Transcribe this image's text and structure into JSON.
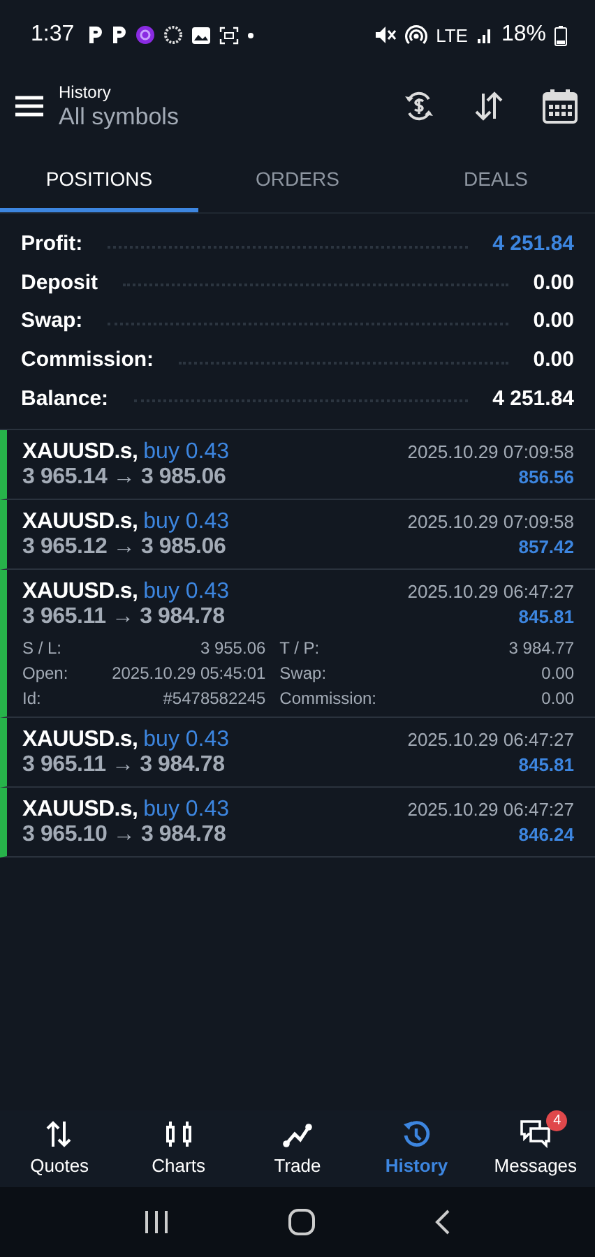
{
  "status_bar": {
    "time": "1:37",
    "network": "LTE",
    "battery": "18%"
  },
  "header": {
    "title": "History",
    "subtitle": "All symbols"
  },
  "tabs": [
    {
      "label": "POSITIONS",
      "selected": true
    },
    {
      "label": "ORDERS",
      "selected": false
    },
    {
      "label": "DEALS",
      "selected": false
    }
  ],
  "summary": [
    {
      "label": "Profit:",
      "value": "4 251.84",
      "highlighted": true
    },
    {
      "label": "Deposit",
      "value": "0.00",
      "highlighted": false
    },
    {
      "label": "Swap:",
      "value": "0.00",
      "highlighted": false
    },
    {
      "label": "Commission:",
      "value": "0.00",
      "highlighted": false
    },
    {
      "label": "Balance:",
      "value": "4 251.84",
      "highlighted": false
    }
  ],
  "positions": [
    {
      "symbol": "XAUUSD.s,",
      "side": "buy 0.43",
      "time": "2025.10.29 07:09:58",
      "prices": "3 965.14 → 3 985.06",
      "profit": "856.56"
    },
    {
      "symbol": "XAUUSD.s,",
      "side": "buy 0.43",
      "time": "2025.10.29 07:09:58",
      "prices": "3 965.12 → 3 985.06",
      "profit": "857.42"
    },
    {
      "symbol": "XAUUSD.s,",
      "side": "buy 0.43",
      "time": "2025.10.29 06:47:27",
      "prices": "3 965.11 → 3 984.78",
      "profit": "845.81",
      "details": [
        {
          "label": "S / L:",
          "value": "3 955.06"
        },
        {
          "label": "T / P:",
          "value": "3 984.77"
        },
        {
          "label": "Open:",
          "value": "2025.10.29 05:45:01"
        },
        {
          "label": "Swap:",
          "value": "0.00"
        },
        {
          "label": "Id:",
          "value": "#5478582245"
        },
        {
          "label": "Commission:",
          "value": "0.00"
        }
      ]
    },
    {
      "symbol": "XAUUSD.s,",
      "side": "buy 0.43",
      "time": "2025.10.29 06:47:27",
      "prices": "3 965.11 → 3 984.78",
      "profit": "845.81"
    },
    {
      "symbol": "XAUUSD.s,",
      "side": "buy 0.43",
      "time": "2025.10.29 06:47:27",
      "prices": "3 965.10 → 3 984.78",
      "profit": "846.24"
    }
  ],
  "nav": [
    {
      "label": "Quotes",
      "selected": false
    },
    {
      "label": "Charts",
      "selected": false
    },
    {
      "label": "Trade",
      "selected": false
    },
    {
      "label": "History",
      "selected": true
    },
    {
      "label": "Messages",
      "selected": false,
      "badge": "4"
    }
  ]
}
